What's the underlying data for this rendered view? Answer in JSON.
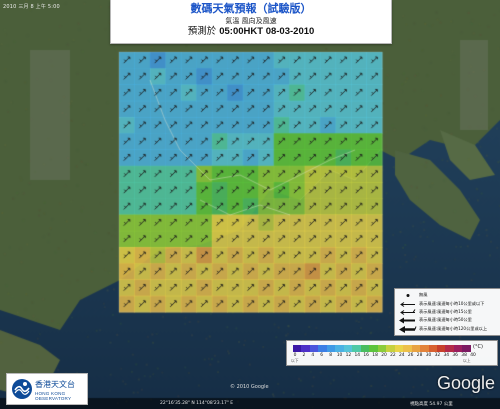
{
  "header": {
    "stamp": "2010 三月 8 上午 5:00",
    "title": "數碼天氣預報（試驗版）",
    "subtitle": "氣溫 風向及風速",
    "time_prefix": "預測於",
    "time_value": "05:00HKT 08-03-2010"
  },
  "legend": {
    "rows": [
      {
        "symbol": "dot",
        "text": "無風"
      },
      {
        "symbol": "arrow1",
        "text": "表示風速:風速每小時10公里或以下"
      },
      {
        "symbol": "arrow2",
        "text": "表示風速:風速每小時15公里"
      },
      {
        "symbol": "arrow3",
        "text": "表示風速:風速每小時50公里"
      },
      {
        "symbol": "arrow4",
        "text": "表示風速:風速每小時120公里或以上"
      }
    ]
  },
  "temperature_scale": {
    "unit": "(°C)",
    "ticks": [
      "0",
      "2",
      "4",
      "6",
      "8",
      "10",
      "12",
      "14",
      "16",
      "18",
      "20",
      "22",
      "24",
      "26",
      "28",
      "30",
      "32",
      "34",
      "36",
      "38",
      "40"
    ],
    "under_label": "以下",
    "over_label": "以上",
    "colors": [
      "#3a17a6",
      "#4c2fc8",
      "#4a55dd",
      "#3b7ee5",
      "#3f9ae6",
      "#4bb2e4",
      "#56c4d9",
      "#4fc9a7",
      "#49bd60",
      "#5cc43c",
      "#8ccc3b",
      "#c6d13f",
      "#e9d449",
      "#edc04a",
      "#e8a343",
      "#e3833a",
      "#d8602f",
      "#c73f2b",
      "#b42a48",
      "#9b1e5e",
      "#7c1a62"
    ]
  },
  "map": {
    "grid_cols": 17,
    "grid_rows": 16,
    "wind_direction": "north-east",
    "land_color": "#4b5f3a",
    "sea_color": "#21425e"
  },
  "logo": {
    "name_zh": "香港天文台",
    "name_en": "HONG KONG OBSERVATORY"
  },
  "attribution": {
    "google": "Google",
    "map_copyright": "© 2010 Google",
    "status_bar": "22°16'35.28\" N  114°08'23.17\" E",
    "imagery": "視點高度 54.97 公里"
  }
}
